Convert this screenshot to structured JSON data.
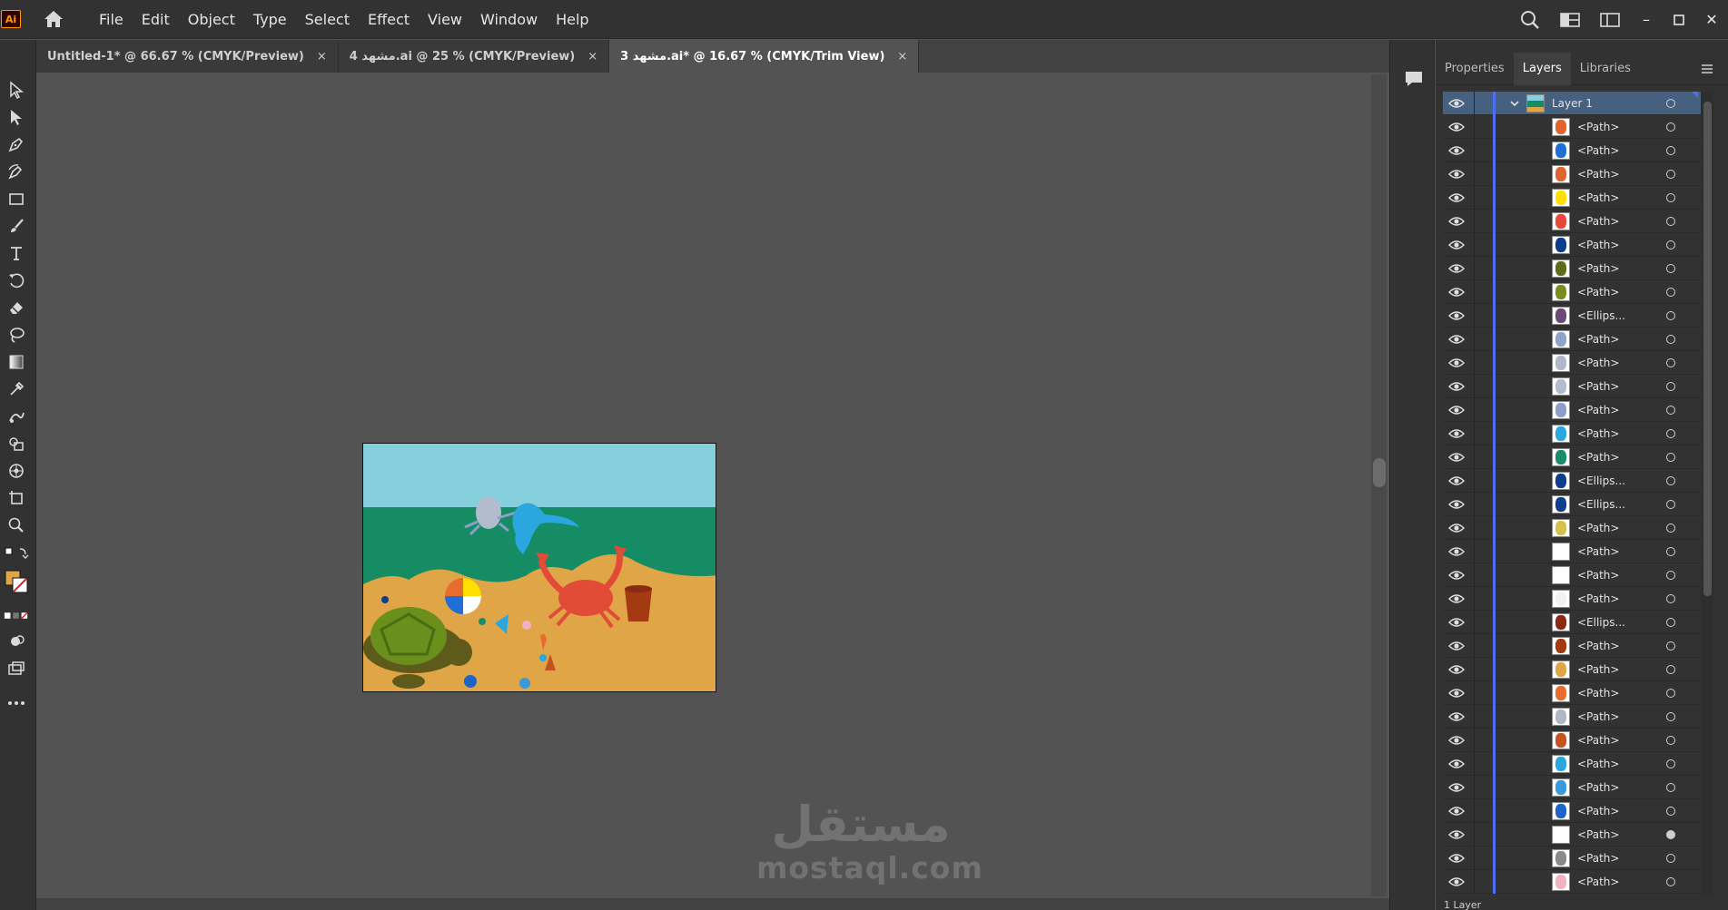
{
  "app": {
    "logo_text": "Ai"
  },
  "menu": {
    "items": [
      "File",
      "Edit",
      "Object",
      "Type",
      "Select",
      "Effect",
      "View",
      "Window",
      "Help"
    ]
  },
  "window_controls": {
    "minimize": "–",
    "restore": "▫",
    "close": "✕"
  },
  "tabs": [
    {
      "label": "Untitled-1* @ 66.67 % (CMYK/Preview)",
      "close": "×",
      "active": false
    },
    {
      "label": "مشهد 4.ai @ 25 % (CMYK/Preview)",
      "close": "×",
      "active": false
    },
    {
      "label": "مشهد 3.ai* @ 16.67 % (CMYK/Trim View)",
      "close": "×",
      "active": true
    }
  ],
  "panel": {
    "tabs": [
      "Properties",
      "Layers",
      "Libraries"
    ],
    "active_tab": "Layers"
  },
  "layers": {
    "top_layer": "Layer 1",
    "rows": [
      {
        "name": "<Path>",
        "thumb": "#e0642f"
      },
      {
        "name": "<Path>",
        "thumb": "#1f6fd6"
      },
      {
        "name": "<Path>",
        "thumb": "#e0642f"
      },
      {
        "name": "<Path>",
        "thumb": "#ffe000"
      },
      {
        "name": "<Path>",
        "thumb": "#e8473a"
      },
      {
        "name": "<Path>",
        "thumb": "#0b3d8c"
      },
      {
        "name": "<Path>",
        "thumb": "#5d6c1c"
      },
      {
        "name": "<Path>",
        "thumb": "#7a8b21"
      },
      {
        "name": "<Ellips...",
        "thumb": "#6b4a7a"
      },
      {
        "name": "<Path>",
        "thumb": "#8fa4c8"
      },
      {
        "name": "<Path>",
        "thumb": "#aeb8c9"
      },
      {
        "name": "<Path>",
        "thumb": "#b3bccc"
      },
      {
        "name": "<Path>",
        "thumb": "#8f9fca"
      },
      {
        "name": "<Path>",
        "thumb": "#2aa7df"
      },
      {
        "name": "<Path>",
        "thumb": "#1a8c6a"
      },
      {
        "name": "<Ellips...",
        "thumb": "#0d3f8a"
      },
      {
        "name": "<Ellips...",
        "thumb": "#0d3f8a"
      },
      {
        "name": "<Path>",
        "thumb": "#d4c24a"
      },
      {
        "name": "<Path>",
        "thumb": "#ffffff"
      },
      {
        "name": "<Path>",
        "thumb": "#ffffff"
      },
      {
        "name": "<Path>",
        "thumb": "#f2f2f2"
      },
      {
        "name": "<Ellips...",
        "thumb": "#8b2a12"
      },
      {
        "name": "<Path>",
        "thumb": "#a33a12"
      },
      {
        "name": "<Path>",
        "thumb": "#e0a546"
      },
      {
        "name": "<Path>",
        "thumb": "#e86c2f"
      },
      {
        "name": "<Path>",
        "thumb": "#b0b8c8"
      },
      {
        "name": "<Path>",
        "thumb": "#c4531f"
      },
      {
        "name": "<Path>",
        "thumb": "#2aa7df"
      },
      {
        "name": "<Path>",
        "thumb": "#3a9ad9"
      },
      {
        "name": "<Path>",
        "thumb": "#1e63c7"
      },
      {
        "name": "<Path>",
        "thumb": "#ffffff"
      },
      {
        "name": "<Path>",
        "thumb": "#8a8a8a"
      },
      {
        "name": "<Path>",
        "thumb": "#f0b4c0"
      }
    ],
    "footer": "1 Layer"
  },
  "watermark": {
    "arabic": "مستقل",
    "latin": "mostaql.com"
  },
  "colors": {
    "sky": "#86cfdd",
    "sea": "#168c64",
    "sand": "#e0a546",
    "crab": "#e24b37",
    "dolphin": "#2aa7df",
    "turtle_shell": "#6a8f1c",
    "turtle_body": "#5d5a1c",
    "selection_blue": "#4f6ef7"
  }
}
